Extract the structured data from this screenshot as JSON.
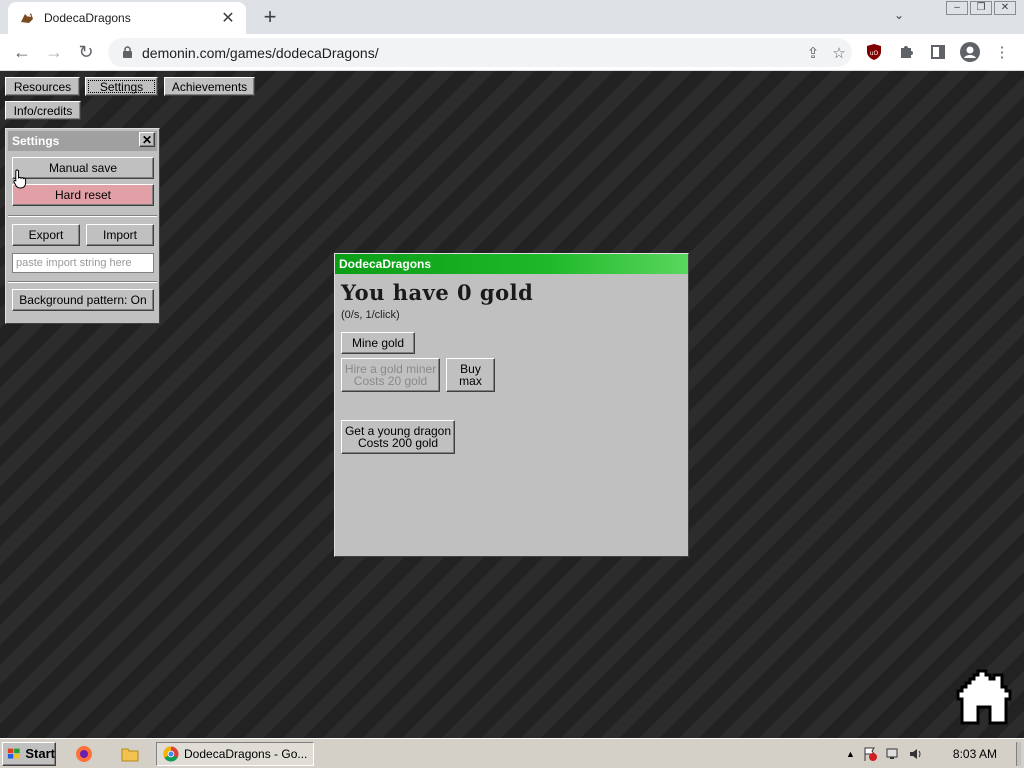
{
  "browser": {
    "tab_title": "DodecaDragons",
    "url": "demonin.com/games/dodecaDragons/"
  },
  "menu": {
    "resources": "Resources",
    "settings": "Settings",
    "achievements": "Achievements",
    "info": "Info/credits"
  },
  "settings_window": {
    "title": "Settings",
    "manual_save": "Manual save",
    "hard_reset": "Hard reset",
    "export": "Export",
    "import": "Import",
    "import_placeholder": "paste import string here",
    "background_pattern": "Background pattern: On"
  },
  "game_window": {
    "title": "DodecaDragons",
    "gold_heading": "You have 0 gold",
    "rate": "(0/s, 1/click)",
    "mine_gold": "Mine gold",
    "hire_miner_line1": "Hire a gold miner",
    "hire_miner_line2": "Costs 20 gold",
    "buy_max_line1": "Buy",
    "buy_max_line2": "max",
    "dragon_line1": "Get a young dragon",
    "dragon_line2": "Costs 200 gold"
  },
  "taskbar": {
    "start": "Start",
    "task_title": "DodecaDragons - Go...",
    "clock": "8:03 AM"
  },
  "colors": {
    "hard_reset_bg": "#e0a0a6",
    "game_titlebar": "#1fb82a",
    "settings_titlebar": "#a0a0a0"
  }
}
